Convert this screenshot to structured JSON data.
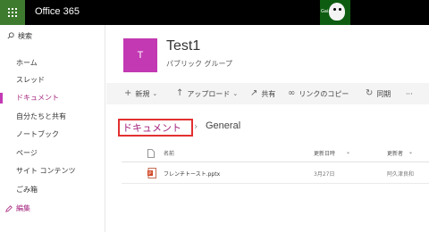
{
  "suite": {
    "app_name": "Office 365",
    "waffle_icon": "app-launcher-icon",
    "user_avatar_label": "Gaia"
  },
  "nav": {
    "search_label": "検索",
    "items": [
      {
        "label": "ホーム",
        "selected": false
      },
      {
        "label": "スレッド",
        "selected": false
      },
      {
        "label": "ドキュメント",
        "selected": true
      },
      {
        "label": "自分たちと共有",
        "selected": false
      },
      {
        "label": "ノートブック",
        "selected": false
      },
      {
        "label": "ページ",
        "selected": false
      },
      {
        "label": "サイト コンテンツ",
        "selected": false
      },
      {
        "label": "ごみ箱",
        "selected": false
      }
    ],
    "edit_label": "編集"
  },
  "site": {
    "logo_letter": "T",
    "title": "Test1",
    "subtitle": "パブリック グループ"
  },
  "commands": {
    "new": "新規",
    "upload": "アップロード",
    "share": "共有",
    "copy_link": "リンクのコピー",
    "sync": "同期",
    "more": "···"
  },
  "breadcrumb": {
    "current": "ドキュメント",
    "separator": "›",
    "next": "General"
  },
  "table": {
    "headers": {
      "name": "名前",
      "modified": "更新日時",
      "modified_by": "更新者"
    },
    "rows": [
      {
        "name": "フレンチトースト.pptx",
        "modified": "3月27日",
        "modified_by": "阿久津良和"
      }
    ]
  },
  "colors": {
    "accent": "#a4237c",
    "site_logo": "#c239b3",
    "waffle": "#3e7b2f",
    "highlight_box": "#e23030"
  }
}
